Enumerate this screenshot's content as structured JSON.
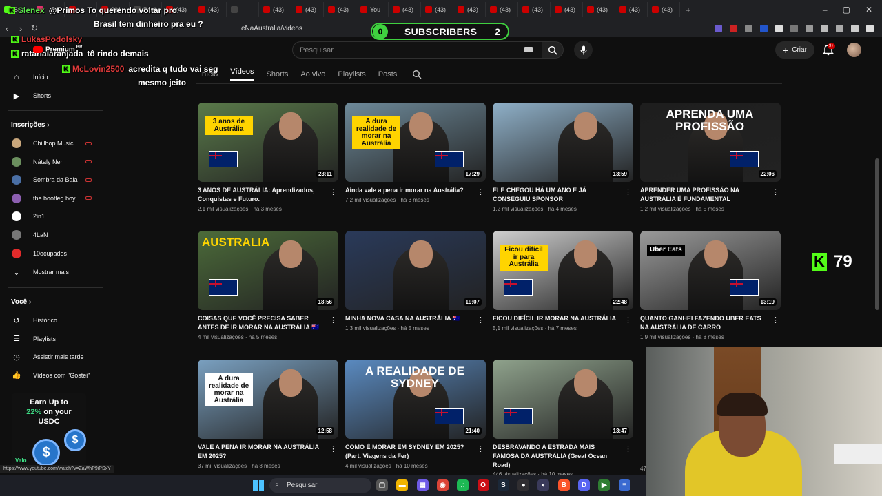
{
  "browser": {
    "tabs": [
      {
        "label": "Stre",
        "color": "#53fc18"
      },
      {
        "label": "",
        "color": "#e1306c"
      },
      {
        "label": "",
        "color": "#cc0000"
      },
      {
        "label": "201",
        "color": "#cc0000"
      },
      {
        "label": "Pági",
        "color": "#444444"
      },
      {
        "label": "(43)",
        "color": "#cc0000"
      },
      {
        "label": "(43)",
        "color": "#cc0000"
      },
      {
        "label": "",
        "color": "#444444"
      },
      {
        "label": "(43)",
        "color": "#cc0000"
      },
      {
        "label": "(43)",
        "color": "#cc0000"
      },
      {
        "label": "(43)",
        "color": "#cc0000"
      },
      {
        "label": "You",
        "color": "#cc0000"
      },
      {
        "label": "(43)",
        "color": "#cc0000"
      },
      {
        "label": "(43)",
        "color": "#cc0000"
      },
      {
        "label": "(43)",
        "color": "#cc0000"
      },
      {
        "label": "(43)",
        "color": "#cc0000"
      },
      {
        "label": "(43)",
        "color": "#cc0000"
      },
      {
        "label": "(43)",
        "color": "#cc0000"
      },
      {
        "label": "(43)",
        "color": "#cc0000"
      },
      {
        "label": "(43)",
        "color": "#cc0000"
      },
      {
        "label": "(43)",
        "color": "#cc0000"
      }
    ],
    "new_tab": "+",
    "url": "eNaAustralia/videos"
  },
  "youtube": {
    "logo_text": "Premium",
    "logo_region": "BR",
    "search_placeholder": "Pesquisar",
    "create_label": "Criar",
    "notif_badge": "9+",
    "channel_tabs": [
      "Início",
      "Vídeos",
      "Shorts",
      "Ao vivo",
      "Playlists",
      "Posts"
    ],
    "sidebar": {
      "top_items": [
        {
          "label": "Início",
          "icon": "home-icon",
          "glyph": "⌂"
        },
        {
          "label": "Shorts",
          "icon": "shorts-icon",
          "glyph": "▶"
        }
      ],
      "subs_heading": "Inscrições",
      "subs": [
        {
          "label": "Chillhop Music",
          "color": "#c9a77c",
          "live": true
        },
        {
          "label": "Nátaly Neri",
          "color": "#6b8f5e",
          "live": true
        },
        {
          "label": "Sombra da Bala",
          "color": "#4a6fa5",
          "live": true
        },
        {
          "label": "the bootleg boy",
          "color": "#8c5fb0",
          "live": true
        },
        {
          "label": "2in1",
          "color": "#ffffff",
          "live": false
        },
        {
          "label": "4LaN",
          "color": "#777777",
          "live": false
        },
        {
          "label": "10ocupados",
          "color": "#e22b2b",
          "live": false
        }
      ],
      "show_more": "Mostrar mais",
      "you_heading": "Você",
      "you_items": [
        {
          "label": "Histórico",
          "icon": "history-icon",
          "glyph": "↺"
        },
        {
          "label": "Playlists",
          "icon": "playlists-icon",
          "glyph": "☰"
        },
        {
          "label": "Assistir mais tarde",
          "icon": "watch-later-icon",
          "glyph": "◷"
        },
        {
          "label": "Vídeos com \"Gostei\"",
          "icon": "liked-icon",
          "glyph": "👍"
        }
      ]
    },
    "videos": [
      {
        "title": "3 ANOS DE AUSTRÁLIA: Aprendizados, Conquistas e Futuro.",
        "meta": "2,1 mil visualizações · há 3 meses",
        "duration": "23:11",
        "caption": "3 anos de Austrália",
        "bg": "#5a7a4a",
        "capColor": "#111",
        "capBg": "#ffd400"
      },
      {
        "title": "Ainda vale a pena ir morar na Austrália?",
        "meta": "7,2 mil visualizações · há 3 meses",
        "duration": "17:29",
        "caption": "A dura realidade de morar na Austrália",
        "bg": "#6e8a9a",
        "capColor": "#111",
        "capBg": "#ffd400"
      },
      {
        "title": "ELE CHEGOU HÁ UM ANO E JÁ CONSEGUIU SPONSOR",
        "meta": "1,2 mil visualizações · há 4 meses",
        "duration": "13:59",
        "caption": "",
        "bg": "#8fb0c8",
        "capColor": "#fff",
        "capBg": "transparent"
      },
      {
        "title": "APRENDER UMA PROFISSÃO NA AUSTRÁLIA É FUNDAMENTAL",
        "meta": "1,2 mil visualizações · há 5 meses",
        "duration": "22:06",
        "caption": "APRENDA UMA PROFISSÃO",
        "bg": "#1e1e1e",
        "capColor": "#fff",
        "capBg": "transparent"
      },
      {
        "title": "COISAS QUE VOCÊ PRECISA SABER ANTES DE IR MORAR NA AUSTRÁLIA 🇦🇺",
        "meta": "4 mil visualizações · há 5 meses",
        "duration": "18:56",
        "caption": "AUSTRALIA",
        "bg": "#4c6b3a",
        "capColor": "#ffd400",
        "capBg": "transparent"
      },
      {
        "title": "MINHA NOVA CASA NA AUSTRÁLIA 🇦🇺",
        "meta": "1,3 mil visualizações · há 5 meses",
        "duration": "19:07",
        "caption": "",
        "bg": "#2a3a5a",
        "capColor": "#fff",
        "capBg": "transparent"
      },
      {
        "title": "FICOU DIFÍCIL IR MORAR NA AUSTRÁLIA",
        "meta": "5,1 mil visualizações · há 7 meses",
        "duration": "22:48",
        "caption": "Ficou difícil ir para Austrália",
        "bg": "#cfcfcf",
        "capColor": "#111",
        "capBg": "#ffd400"
      },
      {
        "title": "QUANTO GANHEI FAZENDO UBER EATS NA AUSTRÁLIA DE CARRO",
        "meta": "1,9 mil visualizações · há 8 meses",
        "duration": "13:19",
        "caption": "Uber Eats",
        "bg": "#9a9a9a",
        "capColor": "#fff",
        "capBg": "#000"
      },
      {
        "title": "VALE A PENA IR MORAR NA AUSTRÁLIA EM 2025?",
        "meta": "37 mil visualizações · há 8 meses",
        "duration": "12:58",
        "caption": "A dura realidade de morar na Austrália",
        "bg": "#7aa0c0",
        "capColor": "#111",
        "capBg": "#fff"
      },
      {
        "title": "COMO É MORAR EM SYDNEY EM 2025? (Part. Viagens da Fer)",
        "meta": "4 mil visualizações · há 10 meses",
        "duration": "21:40",
        "caption": "A REALIDADE DE SYDNEY",
        "bg": "#5a8ac0",
        "capColor": "#fff",
        "capBg": "transparent"
      },
      {
        "title": "DESBRAVANDO A ESTRADA MAIS FAMOSA DA AUSTRÁLIA (Great Ocean Road)",
        "meta": "446 visualizações · há 10 meses",
        "duration": "13:47",
        "caption": "",
        "bg": "#8fa28c",
        "capColor": "#fff",
        "capBg": "transparent"
      }
    ],
    "status_url": "https://www.youtube.com/watch?v=ZaWhP9iPSxY",
    "partial_meta_right": "47"
  },
  "overlay": {
    "sub_goal_left": "0",
    "sub_goal_label": "SUBSCRIBERS",
    "sub_goal_right": "2",
    "chat": [
      {
        "name": "Slenex",
        "text": "@Primos To querendo voltar pro"
      },
      {
        "name": "",
        "text": "Brasil tem dinheiro pra eu ?"
      },
      {
        "name": "LukasPodolsky",
        "text": ""
      },
      {
        "name": "ratarialaranjada",
        "text": "tô rindo demais"
      },
      {
        "name": "McLovin2500",
        "text": "acredita q tudo vai seg"
      },
      {
        "name": "",
        "text": "mesmo jeito"
      }
    ],
    "viewer_count": "79",
    "ad": {
      "line1": "Earn Up to",
      "highlight": "22%",
      "line2": "on your",
      "line3": "USDC",
      "brand": "Valo",
      "coin": "$"
    }
  },
  "taskbar": {
    "search_label": "Pesquisar",
    "apps": [
      {
        "icon": "task-view-icon",
        "color": "#555",
        "glyph": "▢"
      },
      {
        "icon": "file-explorer-icon",
        "color": "#f0b400",
        "glyph": "▬"
      },
      {
        "icon": "apps-icon",
        "color": "#6e5ae6",
        "glyph": "▦"
      },
      {
        "icon": "chrome-icon",
        "color": "#db4437",
        "glyph": "◉"
      },
      {
        "icon": "spotify-icon",
        "color": "#1db954",
        "glyph": "♫"
      },
      {
        "icon": "opera-icon",
        "color": "#cc0f16",
        "glyph": "O"
      },
      {
        "icon": "steam-icon",
        "color": "#1b2838",
        "glyph": "S"
      },
      {
        "icon": "obs-icon",
        "color": "#302e31",
        "glyph": "●"
      },
      {
        "icon": "app-circle-icon",
        "color": "#3a3a5a",
        "glyph": "◐"
      },
      {
        "icon": "brave-icon",
        "color": "#fb542b",
        "glyph": "B"
      },
      {
        "icon": "discord-icon",
        "color": "#5865f2",
        "glyph": "D"
      },
      {
        "icon": "play-icon",
        "color": "#2f7d32",
        "glyph": "▶"
      },
      {
        "icon": "notes-icon",
        "color": "#3a6ad0",
        "glyph": "≡"
      }
    ]
  }
}
